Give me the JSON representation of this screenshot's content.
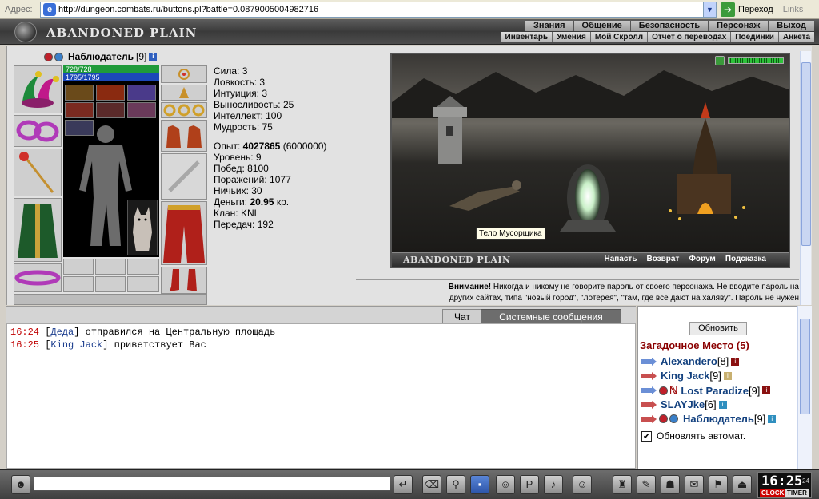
{
  "browser": {
    "address_label": "Адрес:",
    "url": "http://dungeon.combats.ru/buttons.pl?battle=0.0879005004982716",
    "go_label": "Переход",
    "links_label": "Links"
  },
  "header": {
    "location": "ABANDONED PLAIN",
    "top_menu": [
      "Знания",
      "Общение",
      "Безопасность",
      "Персонаж",
      "Выход"
    ],
    "sub_menu": [
      "Инвентарь",
      "Умения",
      "Мой Скролл",
      "Отчет о переводах",
      "Поединки",
      "Анкета"
    ]
  },
  "character": {
    "name": "Наблюдатель",
    "level": "[9]",
    "hp": "728/728",
    "mana": "1795/1795",
    "stats": {
      "strength": "Сила: 3",
      "agility": "Ловкость: 3",
      "intuition": "Интуиция: 3",
      "endurance": "Выносливость: 25",
      "intellect": "Интеллект: 100",
      "wisdom": "Мудрость: 75"
    },
    "exp_label": "Опыт:",
    "exp_value": "4027865",
    "exp_next": "(6000000)",
    "level_line": "Уровень: 9",
    "wins": "Побед: 8100",
    "losses": "Поражений: 1077",
    "draws": "Ничьих: 30",
    "money_label": "Деньги:",
    "money_value": "20.95",
    "money_unit": "кр.",
    "clan": "Клан: KNL",
    "transfers": "Передач: 192"
  },
  "scene": {
    "title": "ABANDONED PLAIN",
    "links": [
      "Напасть",
      "Возврат",
      "Форум",
      "Подсказка"
    ],
    "tooltip": "Тело Мусорщика"
  },
  "warning": {
    "bold": "Внимание!",
    "line1": "Никогда и никому не говорите пароль от своего персонажа. Не вводите пароль на",
    "line2": "других сайтах, типа \"новый город\", \"лотерея\", \"там, где все дают на халяву\". Пароль не нужен"
  },
  "chat": {
    "tab_chat": "Чат",
    "tab_system": "Системные сообщения",
    "messages": [
      {
        "time": "16:24",
        "nick": "Деда",
        "text": "отправился на Центральную площадь"
      },
      {
        "time": "16:25",
        "nick": "King Jack",
        "text": "приветствует Вас"
      }
    ]
  },
  "online": {
    "refresh_label": "Обновить",
    "room_title": "Загадочное Место (5)",
    "users": [
      {
        "name": "Alexandero",
        "level": "[8]"
      },
      {
        "name": "King Jack",
        "level": "[9]"
      },
      {
        "name": "Lost Paradize",
        "level": "[9]"
      },
      {
        "name": "SLAYJke",
        "level": "[6]"
      },
      {
        "name": "Наблюдатель",
        "level": "[9]"
      }
    ],
    "auto_refresh_label": "Обновлять автомат.",
    "auto_refresh_checked": "✔"
  },
  "clock": {
    "time": "16:25",
    "seconds": "24",
    "label_clock": "CLOCK",
    "label_timer": "TIMER"
  },
  "colors": {
    "hp_bar": "#1f9a3a",
    "mana_bar": "#1c48b8",
    "room_title": "#8a0000",
    "nick": "#13417f",
    "time": "#c00000"
  }
}
